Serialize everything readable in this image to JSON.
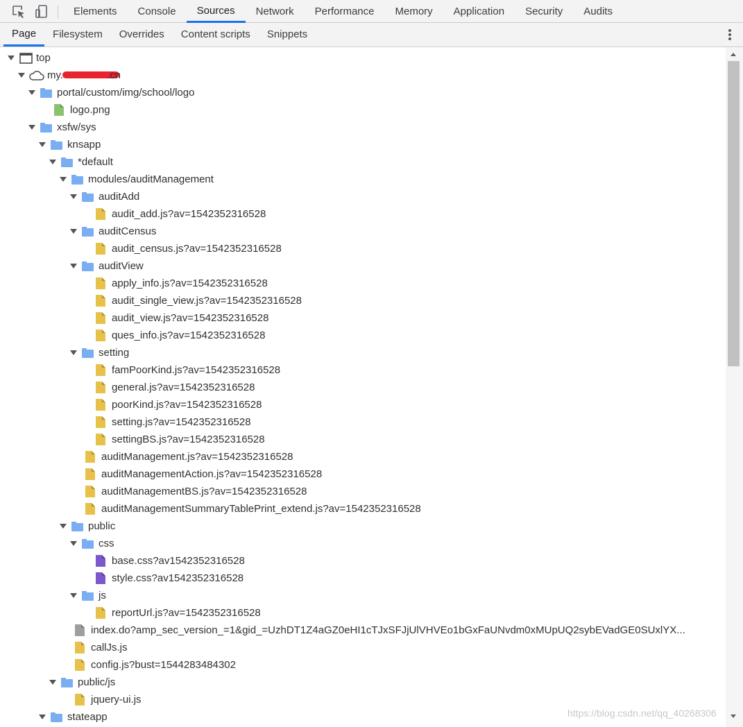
{
  "toolbar": {
    "inspect_icon": "inspect-element-icon",
    "device_icon": "device-toolbar-icon",
    "tabs": [
      "Elements",
      "Console",
      "Sources",
      "Network",
      "Performance",
      "Memory",
      "Application",
      "Security",
      "Audits"
    ],
    "active_tab": "Sources"
  },
  "navigator": {
    "tabs": [
      "Page",
      "Filesystem",
      "Overrides",
      "Content scripts",
      "Snippets"
    ],
    "active_tab": "Page",
    "more_icon": "more-vertical-icon"
  },
  "colors": {
    "folder": "#7aaef2",
    "js_file": "#e8c14a",
    "css_file": "#7b58cc",
    "image_file": "#8bc26e",
    "document_file": "#9e9e9e",
    "accent": "#1a73e8",
    "redaction": "#e8232d"
  },
  "tree": [
    {
      "depth": 0,
      "kind": "frame",
      "expanded": true,
      "label": "top"
    },
    {
      "depth": 1,
      "kind": "cloud",
      "expanded": true,
      "label": "my.",
      "label_suffix": ".cn",
      "redacted": true
    },
    {
      "depth": 2,
      "kind": "folder",
      "expanded": true,
      "label": "portal/custom/img/school/logo"
    },
    {
      "depth": 3,
      "kind": "image",
      "label": "logo.png"
    },
    {
      "depth": 2,
      "kind": "folder",
      "expanded": true,
      "label": "xsfw/sys"
    },
    {
      "depth": 3,
      "kind": "folder",
      "expanded": true,
      "label": "knsapp"
    },
    {
      "depth": 4,
      "kind": "folder",
      "expanded": true,
      "label": "*default"
    },
    {
      "depth": 5,
      "kind": "folder",
      "expanded": true,
      "label": "modules/auditManagement"
    },
    {
      "depth": 6,
      "kind": "folder",
      "expanded": true,
      "label": "auditAdd"
    },
    {
      "depth": 7,
      "kind": "js",
      "label": "audit_add.js?av=1542352316528"
    },
    {
      "depth": 6,
      "kind": "folder",
      "expanded": true,
      "label": "auditCensus"
    },
    {
      "depth": 7,
      "kind": "js",
      "label": "audit_census.js?av=1542352316528"
    },
    {
      "depth": 6,
      "kind": "folder",
      "expanded": true,
      "label": "auditView"
    },
    {
      "depth": 7,
      "kind": "js",
      "label": "apply_info.js?av=1542352316528"
    },
    {
      "depth": 7,
      "kind": "js",
      "label": "audit_single_view.js?av=1542352316528"
    },
    {
      "depth": 7,
      "kind": "js",
      "label": "audit_view.js?av=1542352316528"
    },
    {
      "depth": 7,
      "kind": "js",
      "label": "ques_info.js?av=1542352316528"
    },
    {
      "depth": 6,
      "kind": "folder",
      "expanded": true,
      "label": "setting"
    },
    {
      "depth": 7,
      "kind": "js",
      "label": "famPoorKind.js?av=1542352316528"
    },
    {
      "depth": 7,
      "kind": "js",
      "label": "general.js?av=1542352316528"
    },
    {
      "depth": 7,
      "kind": "js",
      "label": "poorKind.js?av=1542352316528"
    },
    {
      "depth": 7,
      "kind": "js",
      "label": "setting.js?av=1542352316528"
    },
    {
      "depth": 7,
      "kind": "js",
      "label": "settingBS.js?av=1542352316528"
    },
    {
      "depth": 6,
      "kind": "js",
      "label": "auditManagement.js?av=1542352316528"
    },
    {
      "depth": 6,
      "kind": "js",
      "label": "auditManagementAction.js?av=1542352316528"
    },
    {
      "depth": 6,
      "kind": "js",
      "label": "auditManagementBS.js?av=1542352316528"
    },
    {
      "depth": 6,
      "kind": "js",
      "label": "auditManagementSummaryTablePrint_extend.js?av=1542352316528"
    },
    {
      "depth": 5,
      "kind": "folder",
      "expanded": true,
      "label": "public"
    },
    {
      "depth": 6,
      "kind": "folder",
      "expanded": true,
      "label": "css"
    },
    {
      "depth": 7,
      "kind": "css",
      "label": "base.css?av1542352316528"
    },
    {
      "depth": 7,
      "kind": "css",
      "label": "style.css?av1542352316528"
    },
    {
      "depth": 6,
      "kind": "folder",
      "expanded": true,
      "label": "js"
    },
    {
      "depth": 7,
      "kind": "js",
      "label": "reportUrl.js?av=1542352316528"
    },
    {
      "depth": 5,
      "kind": "document",
      "label": "index.do?amp_sec_version_=1&gid_=UzhDT1Z4aGZ0eHI1cTJxSFJjUlVHVEo1bGxFaUNvdm0xMUpUQ2sybEVadGE0SUxlYX..."
    },
    {
      "depth": 5,
      "kind": "js",
      "label": "callJs.js"
    },
    {
      "depth": 5,
      "kind": "js",
      "label": "config.js?bust=1544283484302"
    },
    {
      "depth": 4,
      "kind": "folder",
      "expanded": true,
      "label": "public/js"
    },
    {
      "depth": 5,
      "kind": "js",
      "label": "jquery-ui.js"
    },
    {
      "depth": 3,
      "kind": "folder",
      "expanded": true,
      "label": "stateapp"
    }
  ],
  "watermark": "https://blog.csdn.net/qq_40268306"
}
